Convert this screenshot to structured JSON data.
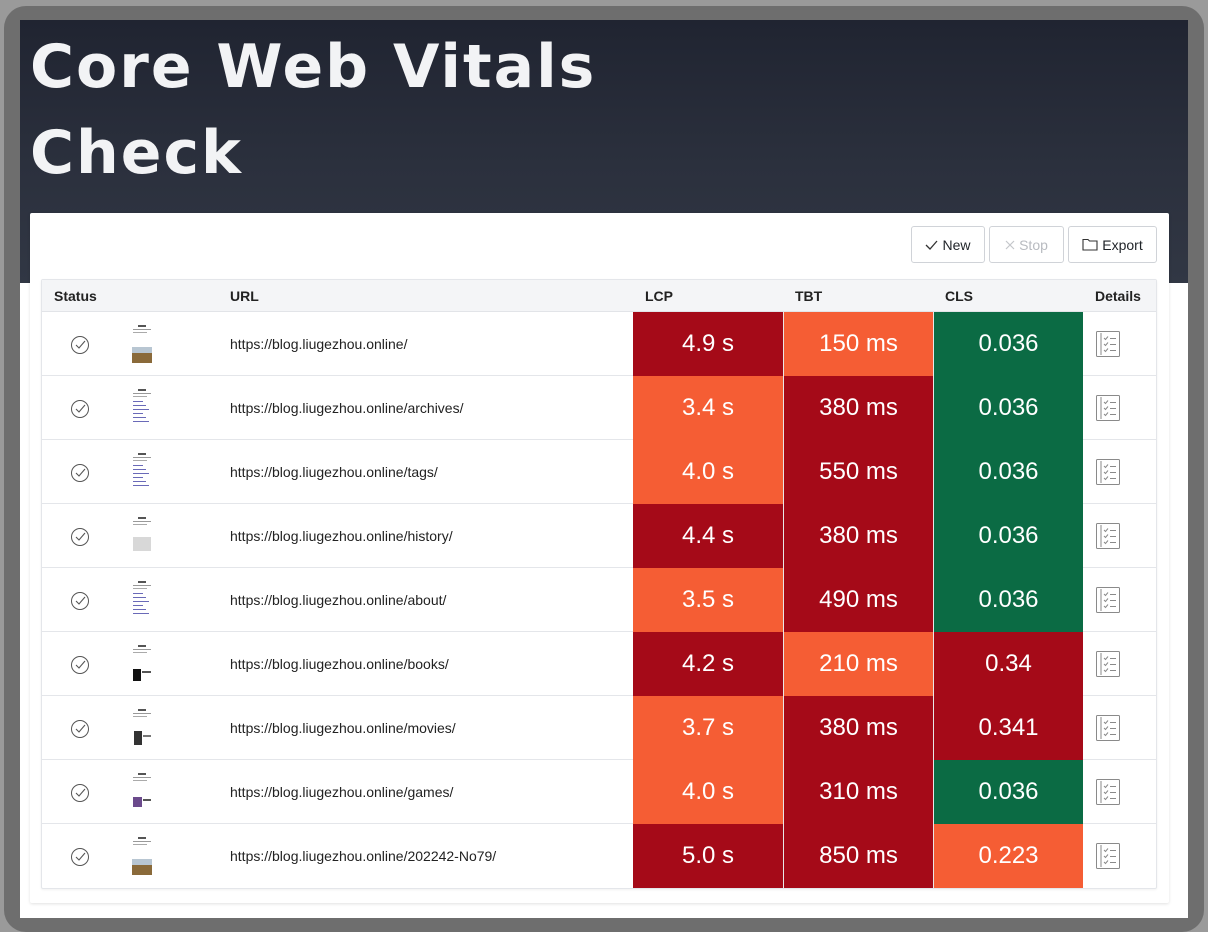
{
  "hero": {
    "title": "Core Web Vitals Check"
  },
  "toolbar": {
    "new_label": "New",
    "stop_label": "Stop",
    "export_label": "Export"
  },
  "table": {
    "headers": {
      "status": "Status",
      "url": "URL",
      "lcp": "LCP",
      "tbt": "TBT",
      "cls": "CLS",
      "details": "Details"
    },
    "rows": [
      {
        "url": "https://blog.liugezhou.online/",
        "lcp": "4.9 s",
        "tbt": "150 ms",
        "cls": "0.036",
        "lcp_status": "poor",
        "tbt_status": "needs-improvement",
        "cls_status": "good",
        "thumb": "photo"
      },
      {
        "url": "https://blog.liugezhou.online/archives/",
        "lcp": "3.4 s",
        "tbt": "380 ms",
        "cls": "0.036",
        "lcp_status": "needs-improvement",
        "tbt_status": "poor",
        "cls_status": "good",
        "thumb": "text"
      },
      {
        "url": "https://blog.liugezhou.online/tags/",
        "lcp": "4.0 s",
        "tbt": "550 ms",
        "cls": "0.036",
        "lcp_status": "needs-improvement",
        "tbt_status": "poor",
        "cls_status": "good",
        "thumb": "text"
      },
      {
        "url": "https://blog.liugezhou.online/history/",
        "lcp": "4.4 s",
        "tbt": "380 ms",
        "cls": "0.036",
        "lcp_status": "poor",
        "tbt_status": "poor",
        "cls_status": "good",
        "thumb": "box"
      },
      {
        "url": "https://blog.liugezhou.online/about/",
        "lcp": "3.5 s",
        "tbt": "490 ms",
        "cls": "0.036",
        "lcp_status": "needs-improvement",
        "tbt_status": "poor",
        "cls_status": "good",
        "thumb": "text"
      },
      {
        "url": "https://blog.liugezhou.online/books/",
        "lcp": "4.2 s",
        "tbt": "210 ms",
        "cls": "0.34",
        "lcp_status": "poor",
        "tbt_status": "needs-improvement",
        "cls_status": "poor",
        "thumb": "dark"
      },
      {
        "url": "https://blog.liugezhou.online/movies/",
        "lcp": "3.7 s",
        "tbt": "380 ms",
        "cls": "0.341",
        "lcp_status": "needs-improvement",
        "tbt_status": "poor",
        "cls_status": "poor",
        "thumb": "figure"
      },
      {
        "url": "https://blog.liugezhou.online/games/",
        "lcp": "4.0 s",
        "tbt": "310 ms",
        "cls": "0.036",
        "lcp_status": "needs-improvement",
        "tbt_status": "poor",
        "cls_status": "good",
        "thumb": "color"
      },
      {
        "url": "https://blog.liugezhou.online/202242-No79/",
        "lcp": "5.0 s",
        "tbt": "850 ms",
        "cls": "0.223",
        "lcp_status": "poor",
        "tbt_status": "poor",
        "cls_status": "needs-improvement",
        "thumb": "photo"
      }
    ]
  },
  "colors": {
    "poor": "#a50a18",
    "needs-improvement": "#f55d34",
    "good": "#0b6b44"
  },
  "icons": {
    "status": "check-circle-icon",
    "details": "list-icon",
    "new": "check-icon",
    "stop": "x-icon",
    "export": "folder-icon"
  }
}
